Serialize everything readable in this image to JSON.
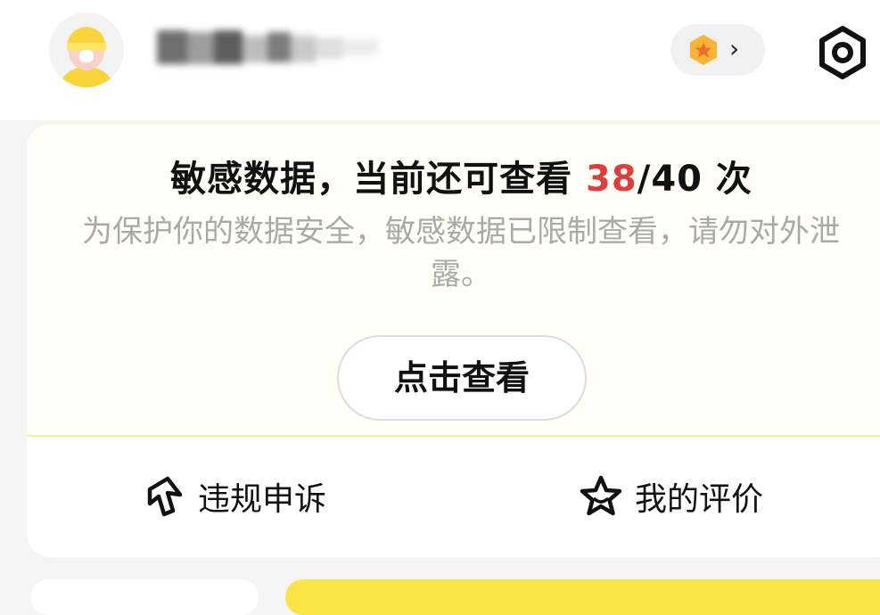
{
  "profile": {
    "avatar": "avatar-person-yellow-helmet",
    "username": "▆▆ ▆▆▆ ▆▆▆"
  },
  "header": {
    "vip_icon": "vip-badge-icon",
    "chevron": "›",
    "settings_icon": "settings-hexagon-icon"
  },
  "sensitive": {
    "title_prefix": "敏感数据，当前还可查看",
    "remaining": "38",
    "total_suffix": "/40 次",
    "description": "为保护你的数据安全，敏感数据已限制查看，请勿对外泄露。",
    "view_button": "点击查看",
    "accent_color": "#e03c3c"
  },
  "actions": {
    "complaint": "违规申诉",
    "review": "我的评价"
  }
}
